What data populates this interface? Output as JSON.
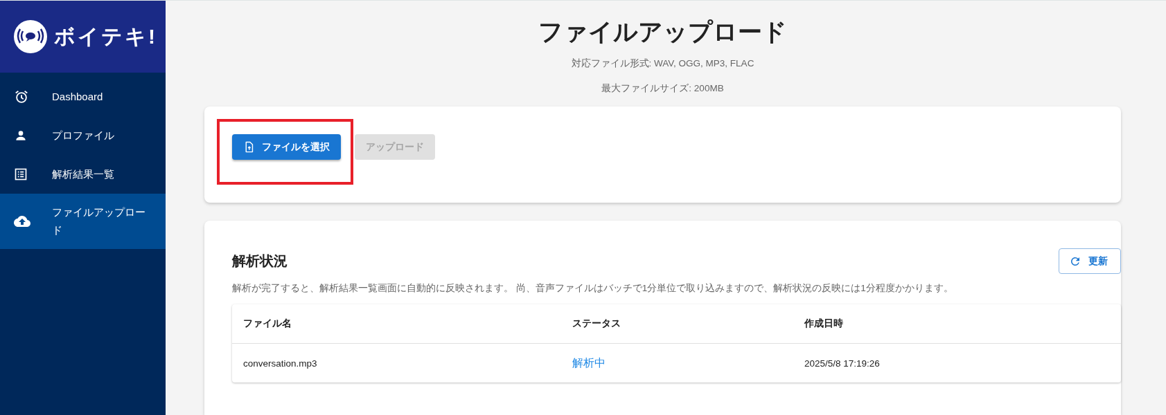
{
  "app": {
    "logo_text": "ボイテキ!"
  },
  "sidebar": {
    "items": [
      {
        "label": "Dashboard",
        "selected": false
      },
      {
        "label": "プロファイル",
        "selected": false
      },
      {
        "label": "解析結果一覧",
        "selected": false
      },
      {
        "label": "ファイルアップロード",
        "selected": true
      }
    ]
  },
  "header": {
    "title": "ファイルアップロード",
    "notes": [
      "対応ファイル形式: WAV, OGG, MP3, FLAC",
      "最大ファイルサイズ: 200MB"
    ]
  },
  "upload_card": {
    "buttons": [
      {
        "label": "ファイルを選択",
        "kind": "primary",
        "disabled": false,
        "highlighted": true
      },
      {
        "label": "アップロード",
        "kind": "plain",
        "disabled": true,
        "highlighted": false
      }
    ]
  },
  "status_card": {
    "title": "解析状況",
    "refresh_button": "更新",
    "note": "解析が完了すると、解析結果一覧画面に自動的に反映されます。 尚、音声ファイルはバッチで1分単位で取り込みますので、解析状況の反映には1分程度かかります。",
    "table": {
      "columns": [
        "ファイル名",
        "ステータス",
        "作成日時"
      ],
      "rows": [
        {
          "file": "conversation.mp3",
          "status": {
            "text": "解析中",
            "kind": "processing"
          },
          "created": "2025/5/8 17:19:26"
        }
      ]
    }
  }
}
